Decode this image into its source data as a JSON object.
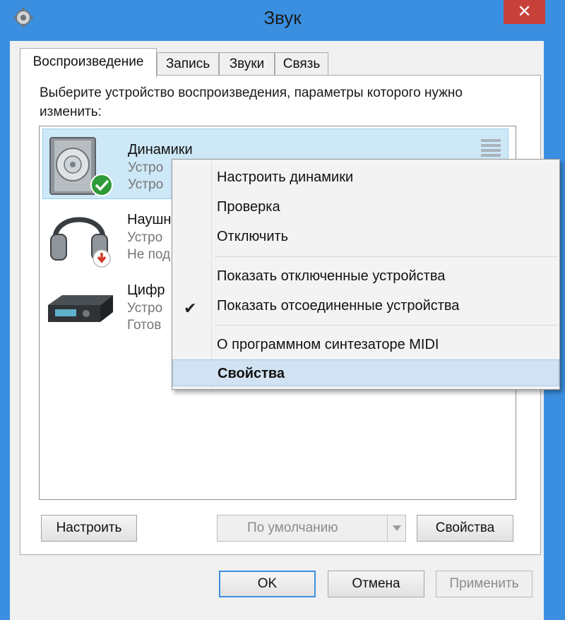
{
  "window": {
    "title": "Звук",
    "close_glyph": "✕",
    "icon": "speaker-settings-icon"
  },
  "tabs": [
    {
      "label": "Воспроизведение",
      "active": true
    },
    {
      "label": "Запись"
    },
    {
      "label": "Звуки"
    },
    {
      "label": "Связь"
    }
  ],
  "instruction": "Выберите устройство воспроизведения, параметры которого нужно изменить:",
  "devices": [
    {
      "name": "Динамики",
      "line1": "Устро",
      "line2": "Устро",
      "icon": "speaker-icon",
      "status_icon": "default-check-icon",
      "selected": true
    },
    {
      "name": "Наушн",
      "line1": "Устро",
      "line2": "Не под",
      "icon": "headphones-icon",
      "status_icon": "disconnected-arrow-icon"
    },
    {
      "name": "Цифр",
      "line1": "Устро",
      "line2": "Готов",
      "icon": "receiver-icon"
    }
  ],
  "context_menu": {
    "items": [
      {
        "label": "Настроить динамики"
      },
      {
        "label": "Проверка"
      },
      {
        "label": "Отключить"
      },
      {
        "label": "Показать отключенные устройства"
      },
      {
        "label": "Показать отсоединенные устройства",
        "checked": true
      },
      {
        "label": "О программном синтезаторе MIDI"
      },
      {
        "label": "Свойства",
        "bold": true,
        "highlighted": true
      }
    ]
  },
  "buttons": {
    "configure": "Настроить",
    "set_default": "По умолчанию",
    "properties": "Свойства",
    "ok": "OK",
    "cancel": "Отмена",
    "apply": "Применить"
  },
  "colors": {
    "frame": "#3b8fe0",
    "close": "#c7403a",
    "selection": "#cde8f7",
    "menu_highlight": "#d1e2f2",
    "status_ok": "#2f9a3a",
    "status_disconnected": "#d13a2a"
  }
}
